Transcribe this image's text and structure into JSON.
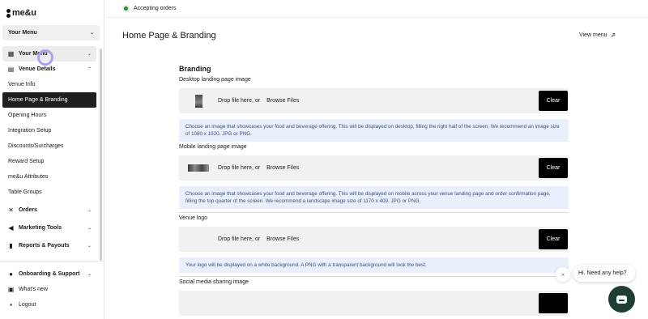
{
  "brand": {
    "logo_text": "me&u"
  },
  "sidebar": {
    "menu_select": "Your Menu",
    "items": [
      {
        "label": "Your Menu",
        "icon": "grid-icon",
        "chevron": "›"
      },
      {
        "label": "Venue Details",
        "icon": "store-icon",
        "chevron": "˄"
      },
      {
        "label": "Venue Info"
      },
      {
        "label": "Home Page & Branding"
      },
      {
        "label": "Opening Hours"
      },
      {
        "label": "Integration Setup"
      },
      {
        "label": "Discounts/Surcharges"
      },
      {
        "label": "Reward Setup"
      },
      {
        "label": "me&u Attributes"
      },
      {
        "label": "Table Groups"
      },
      {
        "label": "Orders",
        "icon": "utensils-icon",
        "chevron": "›"
      },
      {
        "label": "Marketing Tools",
        "icon": "megaphone-icon",
        "chevron": "›"
      },
      {
        "label": "Reports & Payouts",
        "icon": "chart-icon",
        "chevron": "›"
      }
    ],
    "bottom": [
      {
        "label": "Onboarding & Support",
        "icon": "help-icon",
        "chevron": "›"
      },
      {
        "label": "What's new",
        "icon": "gift-icon"
      },
      {
        "label": "Logout",
        "icon": "logout-icon"
      }
    ]
  },
  "topbar": {
    "status": "Accepting orders",
    "status_color": "#2f8f3a"
  },
  "header": {
    "title": "Home Page & Branding",
    "view_menu": "View menu"
  },
  "branding": {
    "section_title": "Branding",
    "fields": [
      {
        "label": "Desktop landing page image",
        "drop_text": "Drop file here, or",
        "browse": "Browse Files",
        "clear": "Clear",
        "info": "Choose an image that showcases your food and beverage offering. This will be displayed on desktop, filling the right half of the screen. We recommend an image size of 1080 x 1920. JPG or PNG."
      },
      {
        "label": "Mobile landing page image",
        "drop_text": "Drop file here, or",
        "browse": "Browse Files",
        "clear": "Clear",
        "info": "Choose an image that showcases your food and beverage offering. This will be displayed on mobile across your venue landing page and order confirmation page, filling the top quarter of the screen. We recommend a landscape image size of 1170 x 409. JPG or PNG."
      },
      {
        "label": "Venue logo",
        "drop_text": "Drop file here, or",
        "browse": "Browse Files",
        "clear": "Clear",
        "info": "Your logo will be displayed on a white background. A PNG with a transparent background will look the best."
      },
      {
        "label": "Social media sharing image"
      }
    ]
  },
  "chat": {
    "prompt": "Hi. Need any help?",
    "close": "×"
  }
}
